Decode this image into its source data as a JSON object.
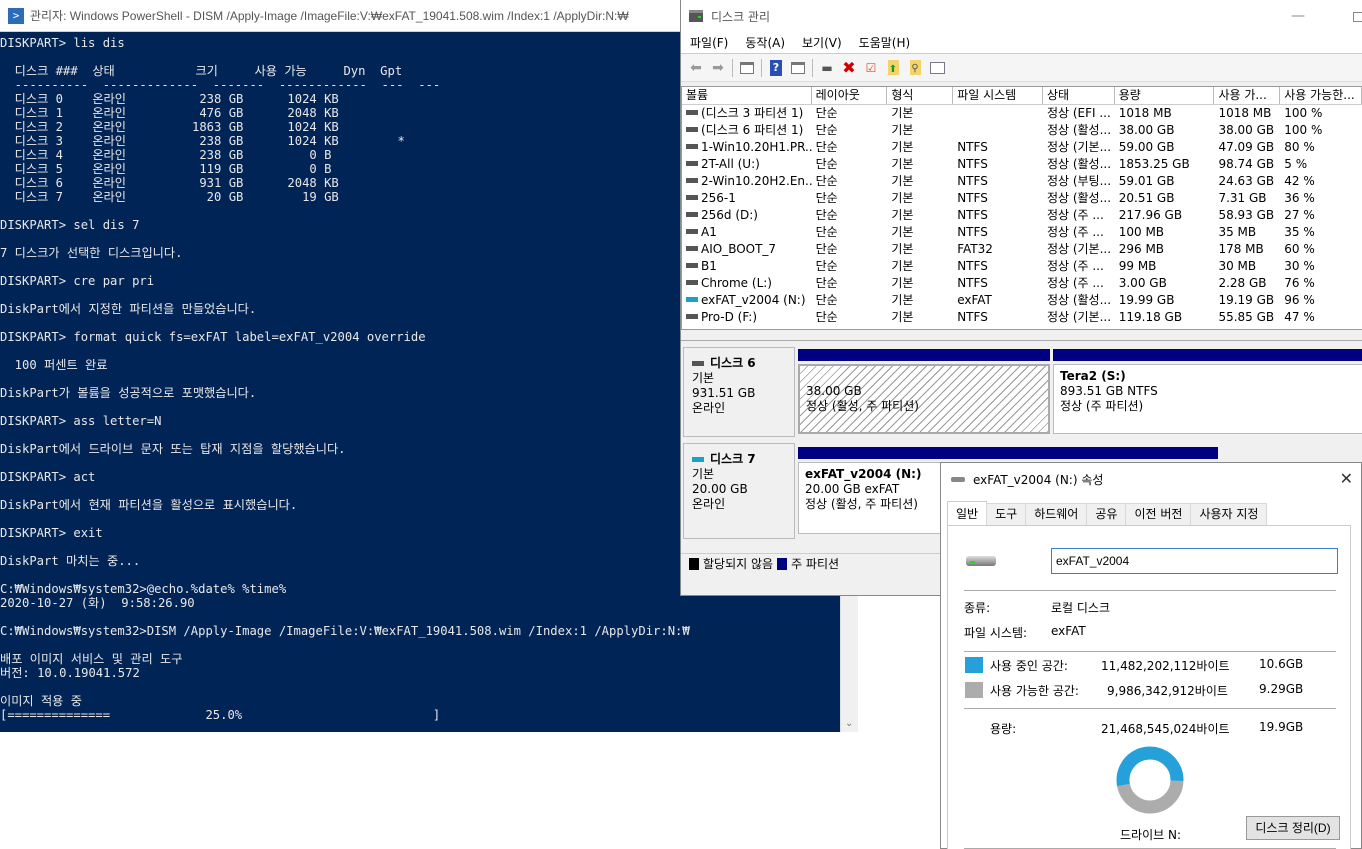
{
  "powershell": {
    "title": "관리자: Windows PowerShell - DISM  /Apply-Image /ImageFile:V:₩exFAT_19041.508.wim /Index:1 /ApplyDir:N:₩",
    "icon": "powershell-icon",
    "lines": [
      "DISKPART> lis dis",
      "",
      "  디스크 ###  상태           크기     사용 가능     Dyn  Gpt",
      "  ----------  -------------  -------  ------------  ---  ---",
      "  디스크 0    온라인          238 GB      1024 KB",
      "  디스크 1    온라인          476 GB      2048 KB",
      "  디스크 2    온라인         1863 GB      1024 KB",
      "  디스크 3    온라인          238 GB      1024 KB        *",
      "  디스크 4    온라인          238 GB         0 B",
      "  디스크 5    온라인          119 GB         0 B",
      "  디스크 6    온라인          931 GB      2048 KB",
      "  디스크 7    온라인           20 GB        19 GB",
      "",
      "DISKPART> sel dis 7",
      "",
      "7 디스크가 선택한 디스크입니다.",
      "",
      "DISKPART> cre par pri",
      "",
      "DiskPart에서 지정한 파티션을 만들었습니다.",
      "",
      "DISKPART> format quick fs=exFAT label=exFAT_v2004 override",
      "",
      "  100 퍼센트 완료",
      "",
      "DiskPart가 볼륨을 성공적으로 포맷했습니다.",
      "",
      "DISKPART> ass letter=N",
      "",
      "DiskPart에서 드라이브 문자 또는 탑재 지점을 할당했습니다.",
      "",
      "DISKPART> act",
      "",
      "DiskPart에서 현재 파티션을 활성으로 표시했습니다.",
      "",
      "DISKPART> exit",
      "",
      "DiskPart 마치는 중...",
      "",
      "C:₩Windows₩system32>@echo.%date% %time%",
      "2020-10-27 (화)  9:58:26.90",
      "",
      "C:₩Windows₩system32>DISM /Apply-Image /ImageFile:V:₩exFAT_19041.508.wim /Index:1 /ApplyDir:N:₩",
      "",
      "배포 이미지 서비스 및 관리 도구",
      "버전: 10.0.19041.572",
      "",
      "이미지 적용 중",
      "[==============             25.0%                          ]"
    ],
    "progress_percent": 25.0
  },
  "disk_management": {
    "title": "디스크 관리",
    "menu": [
      "파일(F)",
      "동작(A)",
      "보기(V)",
      "도움말(H)"
    ],
    "toolbar": [
      "back-arrow-icon",
      "forward-arrow-icon",
      "console-tree-icon",
      "help-icon",
      "action-pane-icon",
      "connect-disk-icon",
      "delete-icon",
      "properties-icon",
      "folder-up-icon",
      "folder-search-icon",
      "checklist-icon"
    ],
    "columns": [
      "볼륨",
      "레이아웃",
      "형식",
      "파일 시스템",
      "상태",
      "용량",
      "사용 가...",
      "사용 가능한..."
    ],
    "volumes": [
      {
        "name": "(디스크 3 파티션 1)",
        "layout": "단순",
        "type": "기본",
        "fs": "",
        "status": "정상 (EFI ...",
        "capacity": "1018 MB",
        "free": "1018 MB",
        "pct": "100 %",
        "highlight": false
      },
      {
        "name": "(디스크 6 파티션 1)",
        "layout": "단순",
        "type": "기본",
        "fs": "",
        "status": "정상 (활성...",
        "capacity": "38.00 GB",
        "free": "38.00 GB",
        "pct": "100 %",
        "highlight": false
      },
      {
        "name": "1-Win10.20H1.PR...",
        "layout": "단순",
        "type": "기본",
        "fs": "NTFS",
        "status": "정상 (기본...",
        "capacity": "59.00 GB",
        "free": "47.09 GB",
        "pct": "80 %",
        "highlight": false
      },
      {
        "name": "2T-All (U:)",
        "layout": "단순",
        "type": "기본",
        "fs": "NTFS",
        "status": "정상 (활성...",
        "capacity": "1853.25 GB",
        "free": "98.74 GB",
        "pct": "5 %",
        "highlight": false
      },
      {
        "name": "2-Win10.20H2.En...",
        "layout": "단순",
        "type": "기본",
        "fs": "NTFS",
        "status": "정상 (부팅...",
        "capacity": "59.01 GB",
        "free": "24.63 GB",
        "pct": "42 %",
        "highlight": false
      },
      {
        "name": "256-1",
        "layout": "단순",
        "type": "기본",
        "fs": "NTFS",
        "status": "정상 (활성...",
        "capacity": "20.51 GB",
        "free": "7.31 GB",
        "pct": "36 %",
        "highlight": false
      },
      {
        "name": "256d (D:)",
        "layout": "단순",
        "type": "기본",
        "fs": "NTFS",
        "status": "정상 (주 ...",
        "capacity": "217.96 GB",
        "free": "58.93 GB",
        "pct": "27 %",
        "highlight": false
      },
      {
        "name": "A1",
        "layout": "단순",
        "type": "기본",
        "fs": "NTFS",
        "status": "정상 (주 ...",
        "capacity": "100 MB",
        "free": "35 MB",
        "pct": "35 %",
        "highlight": false
      },
      {
        "name": "AIO_BOOT_7",
        "layout": "단순",
        "type": "기본",
        "fs": "FAT32",
        "status": "정상 (기본...",
        "capacity": "296 MB",
        "free": "178 MB",
        "pct": "60 %",
        "highlight": false
      },
      {
        "name": "B1",
        "layout": "단순",
        "type": "기본",
        "fs": "NTFS",
        "status": "정상 (주 ...",
        "capacity": "99 MB",
        "free": "30 MB",
        "pct": "30 %",
        "highlight": false
      },
      {
        "name": "Chrome (L:)",
        "layout": "단순",
        "type": "기본",
        "fs": "NTFS",
        "status": "정상 (주 ...",
        "capacity": "3.00 GB",
        "free": "2.28 GB",
        "pct": "76 %",
        "highlight": false
      },
      {
        "name": "exFAT_v2004 (N:)",
        "layout": "단순",
        "type": "기본",
        "fs": "exFAT",
        "status": "정상 (활성...",
        "capacity": "19.99 GB",
        "free": "19.19 GB",
        "pct": "96 %",
        "highlight": true
      },
      {
        "name": "Pro-D (F:)",
        "layout": "단순",
        "type": "기본",
        "fs": "NTFS",
        "status": "정상 (기본...",
        "capacity": "119.18 GB",
        "free": "55.85 GB",
        "pct": "47 %",
        "highlight": false
      }
    ],
    "disks": [
      {
        "name": "디스크 6",
        "kind": "기본",
        "size": "931.51 GB",
        "state": "온라인",
        "partitions": [
          {
            "label": "",
            "size": "38.00 GB",
            "status": "정상 (활성, 주 파티션)"
          },
          {
            "label": "Tera2  (S:)",
            "size": "893.51 GB NTFS",
            "status": "정상 (주 파티션)"
          }
        ]
      },
      {
        "name": "디스크 7",
        "kind": "기본",
        "size": "20.00 GB",
        "state": "온라인",
        "partitions": [
          {
            "label": "exFAT_v2004  (N:)",
            "size": "20.00 GB exFAT",
            "status": "정상 (활성, 주 파티션)"
          }
        ]
      }
    ],
    "legend": [
      {
        "label": "할당되지 않음",
        "color": "#000000"
      },
      {
        "label": "주 파티션",
        "color": "#000080"
      }
    ]
  },
  "properties": {
    "title": "exFAT_v2004 (N:) 속성",
    "tabs": [
      "일반",
      "도구",
      "하드웨어",
      "공유",
      "이전 버전",
      "사용자 지정"
    ],
    "active_tab": "일반",
    "volume_label": "exFAT_v2004",
    "type_label": "종류:",
    "type_value": "로컬 디스크",
    "fs_label": "파일 시스템:",
    "fs_value": "exFAT",
    "used_label": "사용 중인 공간:",
    "used_bytes": "11,482,202,112바이트",
    "used_gb": "10.6GB",
    "used_color": "#26a0da",
    "free_label": "사용 가능한 공간:",
    "free_bytes": "9,986,342,912바이트",
    "free_gb": "9.29GB",
    "free_color": "#acacac",
    "capacity_label": "용량:",
    "capacity_bytes": "21,468,545,024바이트",
    "capacity_gb": "19.9GB",
    "used_fraction": 0.535,
    "drive_label": "드라이브 N:",
    "cleanup_button": "디스크 정리(D)",
    "close_icon": "close-icon"
  }
}
